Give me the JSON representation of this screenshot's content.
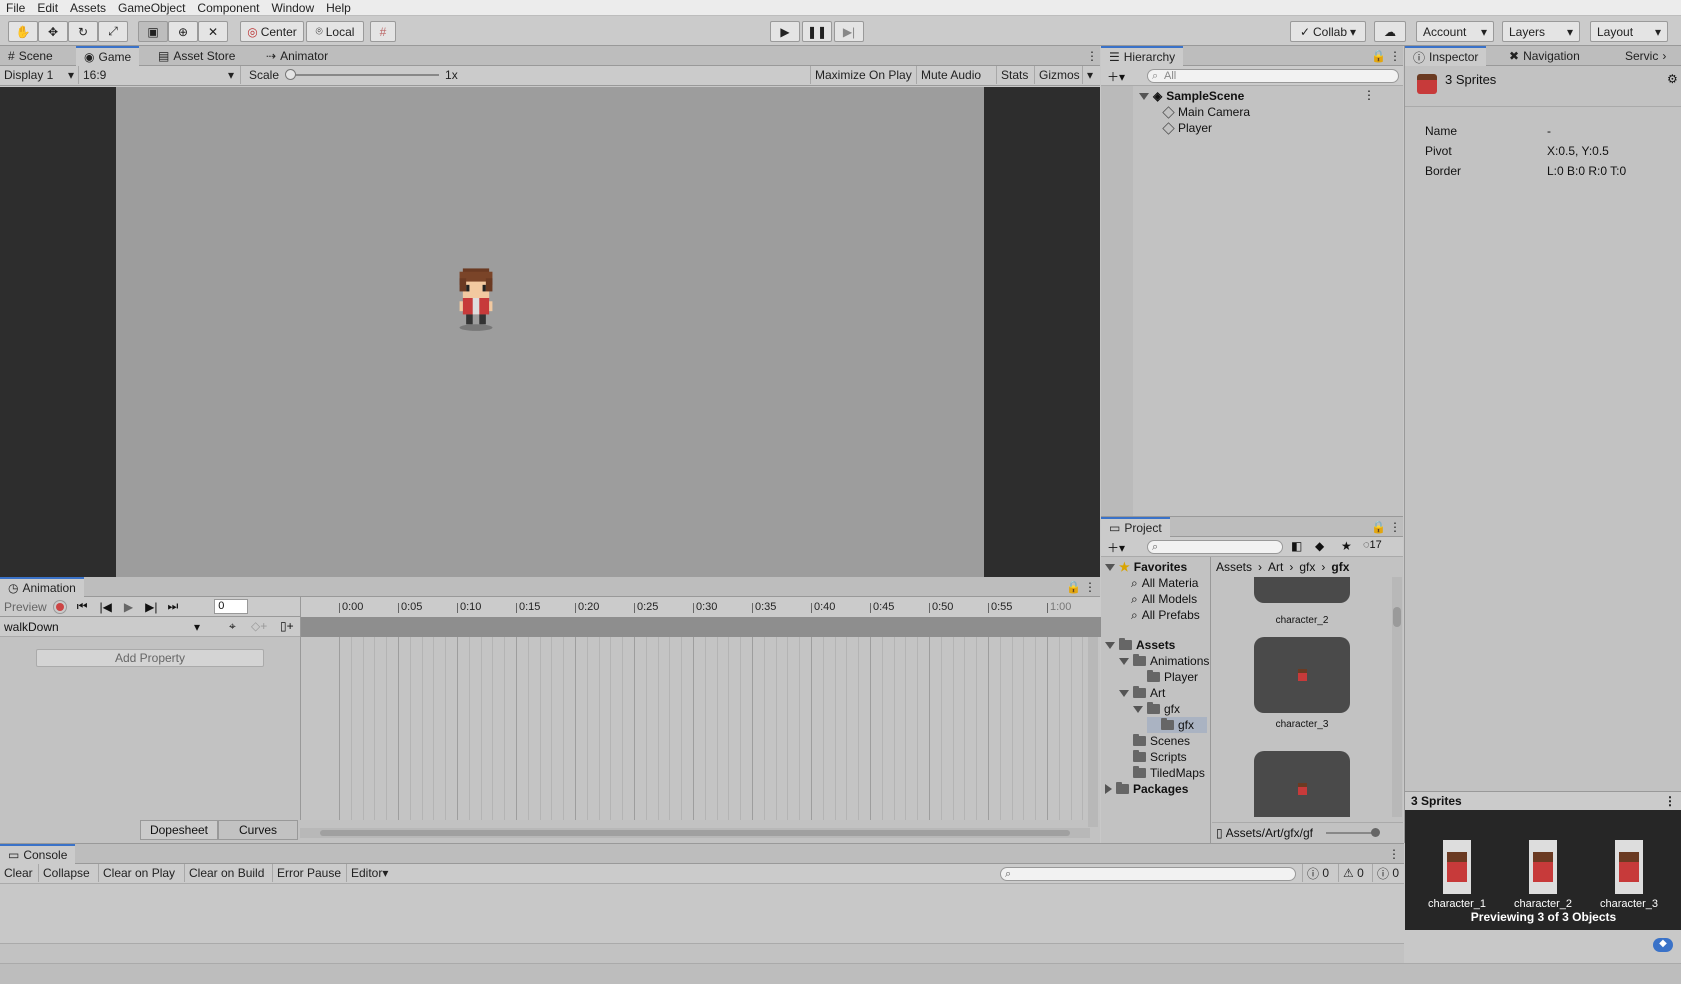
{
  "menu": [
    "File",
    "Edit",
    "Assets",
    "GameObject",
    "Component",
    "Window",
    "Help"
  ],
  "toolbar": {
    "center_label": "Center",
    "local_label": "Local",
    "collab_label": "Collab",
    "account_label": "Account",
    "layers_label": "Layers",
    "layout_label": "Layout"
  },
  "game_tabs": [
    "Scene",
    "Game",
    "Asset Store",
    "Animator"
  ],
  "game_bar": {
    "display": "Display 1",
    "aspect": "16:9",
    "scale_label": "Scale",
    "scale_value": "1x",
    "maximize": "Maximize On Play",
    "mute": "Mute Audio",
    "stats": "Stats",
    "gizmos": "Gizmos"
  },
  "hierarchy": {
    "tab": "Hierarchy",
    "search_placeholder": "All",
    "scene": "SampleScene",
    "items": [
      "Main Camera",
      "Player"
    ]
  },
  "inspector": {
    "tabs": [
      "Inspector",
      "Navigation",
      "Servic"
    ],
    "title": "3 Sprites",
    "rows": [
      {
        "label": "Name",
        "value": "-"
      },
      {
        "label": "Pivot",
        "value": "X:0.5, Y:0.5"
      },
      {
        "label": "Border",
        "value": "L:0 B:0 R:0 T:0"
      }
    ],
    "preview_header": "3 Sprites",
    "thumbs": [
      "character_1",
      "character_2",
      "character_3"
    ],
    "preview_caption": "Previewing 3 of 3 Objects"
  },
  "animation": {
    "tab": "Animation",
    "preview_label": "Preview",
    "frame": "0",
    "clip": "walkDown",
    "add_property": "Add Property",
    "dopesheet": "Dopesheet",
    "curves": "Curves",
    "ruler": [
      "0:00",
      "0:05",
      "0:10",
      "0:15",
      "0:20",
      "0:25",
      "0:30",
      "0:35",
      "0:40",
      "0:45",
      "0:50",
      "0:55",
      "1:00"
    ]
  },
  "project": {
    "tab": "Project",
    "count": "17",
    "favorites": "Favorites",
    "fav_items": [
      "All Materia",
      "All Models",
      "All Prefabs"
    ],
    "assets": "Assets",
    "tree": [
      {
        "label": "Animations",
        "depth": 1,
        "open": true
      },
      {
        "label": "Player",
        "depth": 2,
        "open": false
      },
      {
        "label": "Art",
        "depth": 1,
        "open": true
      },
      {
        "label": "gfx",
        "depth": 2,
        "open": true
      },
      {
        "label": "gfx",
        "depth": 3,
        "open": false
      },
      {
        "label": "Scenes",
        "depth": 1,
        "open": false
      },
      {
        "label": "Scripts",
        "depth": 1,
        "open": false
      },
      {
        "label": "TiledMaps",
        "depth": 1,
        "open": false
      }
    ],
    "packages": "Packages",
    "breadcrumb": [
      "Assets",
      "Art",
      "gfx",
      "gfx"
    ],
    "grid_items": [
      "character_2",
      "character_3"
    ],
    "path": "Assets/Art/gfx/gf"
  },
  "console": {
    "tab": "Console",
    "buttons": [
      "Clear",
      "Collapse",
      "Clear on Play",
      "Clear on Build",
      "Error Pause",
      "Editor"
    ],
    "counts": [
      "0",
      "0",
      "0"
    ]
  }
}
